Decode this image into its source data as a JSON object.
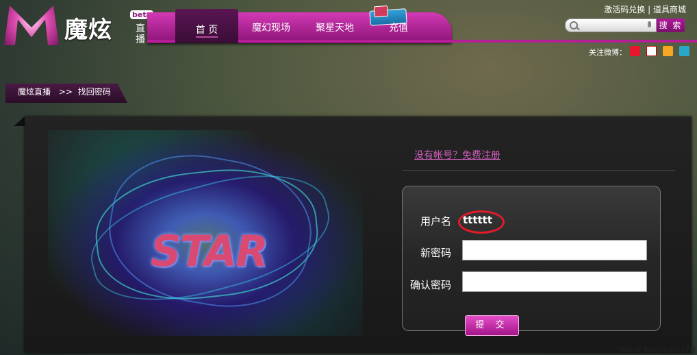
{
  "header": {
    "logo_name": "魔炫",
    "logo_sub": "直播",
    "beta": "beta",
    "nav": [
      "首 页",
      "魔幻现场",
      "聚星天地",
      "充值"
    ],
    "top_links": [
      "激活码兑换",
      "道具商城"
    ],
    "search_button": "搜 索",
    "weibo_label": "关注微博："
  },
  "breadcrumb": {
    "root": "魔炫直播",
    "sep": ">>",
    "current": "找回密码"
  },
  "form": {
    "register_link": "没有帐号？免费注册",
    "username_label": "用户名",
    "username_value": "tttttt",
    "new_password_label": "新密码",
    "confirm_password_label": "确认密码",
    "submit": "提 交"
  },
  "hero_text": "STAR",
  "watermark": "www.wooyun.org"
}
